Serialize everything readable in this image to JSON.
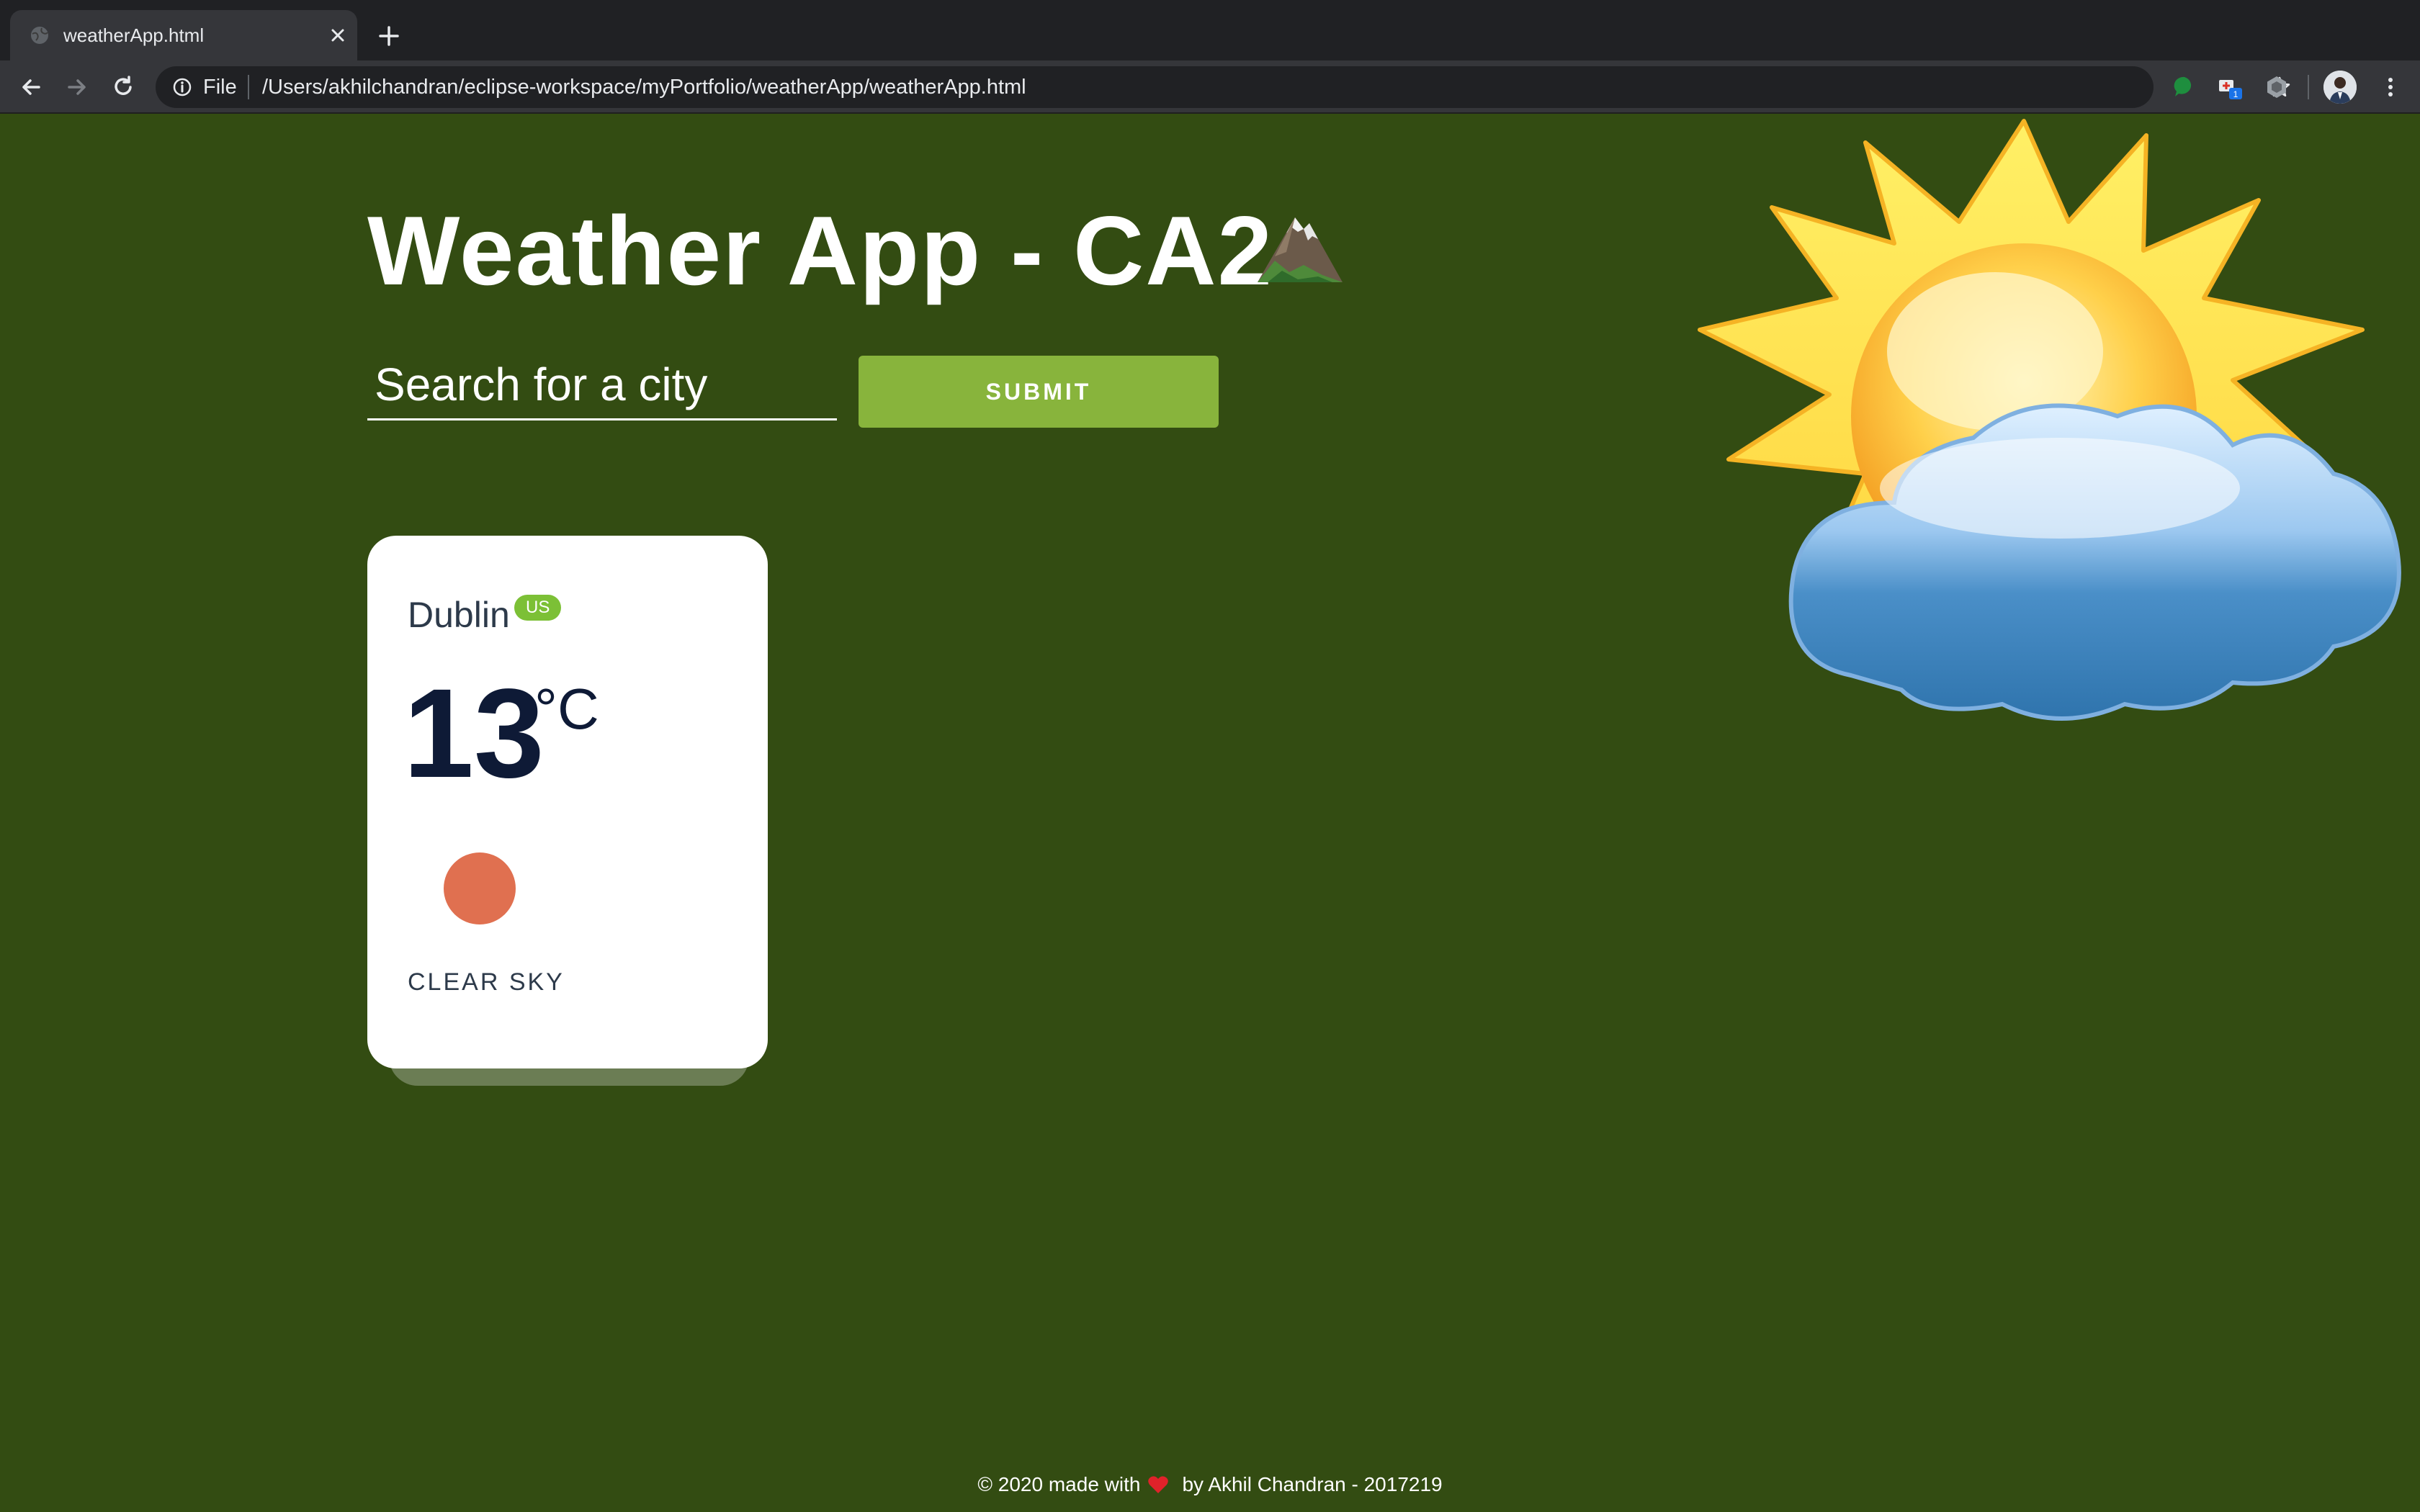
{
  "browser": {
    "tab_title": "weatherApp.html",
    "url_scheme": "File",
    "url": "/Users/akhilchandran/eclipse-workspace/myPortfolio/weatherApp/weatherApp.html",
    "extension_badge": "1"
  },
  "app": {
    "title": "Weather App - CA2",
    "search_placeholder": "Search for a city",
    "submit_label": "SUBMIT",
    "accent_color": "#88b43c",
    "background_color": "#334c12"
  },
  "city_card": {
    "city": "Dublin",
    "country": "US",
    "temperature": "13",
    "unit": "°C",
    "description": "CLEAR SKY",
    "icon": "weather-status-icon"
  },
  "footer": {
    "prefix": "© 2020 made with",
    "suffix": "by Akhil Chandran - 2017219"
  }
}
